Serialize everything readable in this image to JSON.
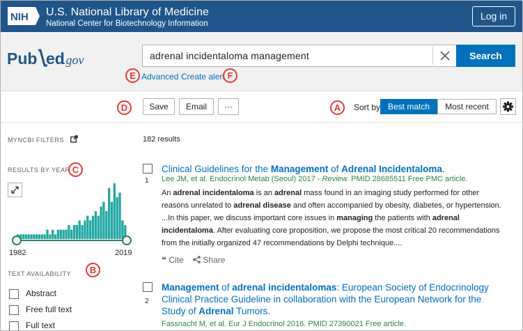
{
  "nih_banner": {
    "logo_text": "NIH",
    "title": "U.S. National Library of Medicine",
    "subtitle": "National Center for Biotechnology Information",
    "login_label": "Log in"
  },
  "search": {
    "logo_text": "PubMed.gov",
    "query": "adrenal incidentaloma management",
    "search_label": "Search",
    "advanced_label": "Advanced",
    "create_alert_label": "Create alert"
  },
  "toolbar": {
    "save_label": "Save",
    "email_label": "Email",
    "more_label": "···",
    "sort_by_label": "Sort by",
    "sort_best_label": "Best match",
    "sort_recent_label": "Most recent",
    "sort_selected": "Best match"
  },
  "sidebar": {
    "myncbi_filters": "MYNCBI FILTERS",
    "results_by_year": "RESULTS BY YEAR",
    "year_start": "1982",
    "year_end": "2019",
    "text_availability": "TEXT AVAILABILITY",
    "filters": [
      {
        "label": "Abstract",
        "checked": false
      },
      {
        "label": "Free full text",
        "checked": false
      },
      {
        "label": "Full text",
        "checked": false
      }
    ]
  },
  "chart_data": {
    "type": "bar",
    "xlim": [
      "1982",
      "2019"
    ],
    "values": [
      1,
      1,
      1,
      1,
      1,
      1,
      1,
      1,
      1,
      1,
      1,
      2,
      1,
      2,
      1,
      2,
      2,
      2,
      2,
      3,
      2,
      3,
      3,
      4,
      3,
      4,
      5,
      4,
      5,
      6,
      5,
      7,
      8,
      6,
      11,
      8,
      12,
      9,
      10,
      4,
      3
    ]
  },
  "results": {
    "count_text": "182 results",
    "items": [
      {
        "num": "1",
        "title_parts": [
          {
            "text": "Clinical Guidelines for the ",
            "bold": false
          },
          {
            "text": "Management",
            "bold": true
          },
          {
            "text": " of ",
            "bold": false
          },
          {
            "text": "Adrenal Incidentaloma",
            "bold": true
          },
          {
            "text": ".",
            "bold": false
          }
        ],
        "meta_authors": "Lee JM, et al. Endocrinol Metab (Seoul) 2017 - ",
        "meta_review": "Review.",
        "meta_rest": " PMID 28685511 Free PMC article.",
        "snippet_parts": [
          {
            "text": "An ",
            "bold": false
          },
          {
            "text": "adrenal incidentaloma",
            "bold": true
          },
          {
            "text": " is an ",
            "bold": false
          },
          {
            "text": "adrenal",
            "bold": true
          },
          {
            "text": " mass found in an imaging study performed for other reasons unrelated to ",
            "bold": false
          },
          {
            "text": "adrenal disease",
            "bold": true
          },
          {
            "text": " and often accompanied by obesity, diabetes, or hypertension. ...In this paper, we discuss important core issues in ",
            "bold": false
          },
          {
            "text": "managing",
            "bold": true
          },
          {
            "text": " the patients with ",
            "bold": false
          },
          {
            "text": "adrenal incidentaloma",
            "bold": true
          },
          {
            "text": ". After evaluating core proposition, we propose the most critical 20 recommendations from the initially organized 47 recommendations by Delphi technique....",
            "bold": false
          }
        ],
        "cite_label": "Cite",
        "share_label": "Share"
      },
      {
        "num": "2",
        "title_parts": [
          {
            "text": "Management",
            "bold": true
          },
          {
            "text": " of ",
            "bold": false
          },
          {
            "text": "adrenal incidentalomas",
            "bold": true
          },
          {
            "text": ": European Society of Endocrinology Clinical Practice Guideline in collaboration with the European Network for the Study of ",
            "bold": false
          },
          {
            "text": "Adrenal",
            "bold": true
          },
          {
            "text": " Tumors.",
            "bold": false
          }
        ],
        "meta": "Fassnacht M, et al. Eur J Endocrinol 2016. PMID 27390021 Free article."
      }
    ]
  },
  "annotations": {
    "a": "A",
    "b": "B",
    "c": "C",
    "d": "D",
    "e": "E",
    "f": "F"
  },
  "colors": {
    "nih_blue": "#20558a",
    "link_blue": "#0071bc",
    "histogram_teal": "#20a7a0",
    "annotation_red": "#e53935",
    "meta_green": "#2e8540"
  }
}
